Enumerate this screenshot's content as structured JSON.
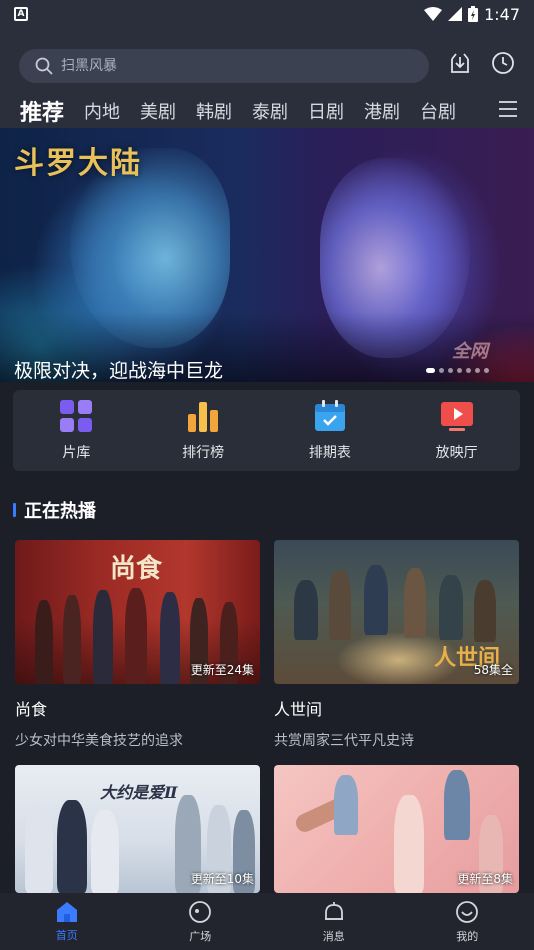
{
  "status_bar": {
    "time": "1:47"
  },
  "search": {
    "placeholder": "扫黑风暴"
  },
  "tabs": [
    {
      "label": "推荐"
    },
    {
      "label": "内地"
    },
    {
      "label": "美剧"
    },
    {
      "label": "韩剧"
    },
    {
      "label": "泰剧"
    },
    {
      "label": "日剧"
    },
    {
      "label": "港剧"
    },
    {
      "label": "台剧"
    }
  ],
  "banner": {
    "logo_text": "斗罗大陆",
    "caption": "极限对决，迎战海中巨龙",
    "watermark": "全网",
    "slide_count": 7,
    "active_slide": 1
  },
  "quick_links": [
    {
      "label": "片库",
      "icon": "grid-icon"
    },
    {
      "label": "排行榜",
      "icon": "bar-chart-icon"
    },
    {
      "label": "排期表",
      "icon": "calendar-icon"
    },
    {
      "label": "放映厅",
      "icon": "play-screen-icon"
    }
  ],
  "section": {
    "title": "正在热播"
  },
  "cards": [
    {
      "title": "尚食",
      "subtitle": "少女对中华美食技艺的追求",
      "badge": "更新至24集",
      "poster_text": "尚食"
    },
    {
      "title": "人世间",
      "subtitle": "共赏周家三代平凡史诗",
      "badge": "58集全",
      "poster_text": "人世间"
    },
    {
      "title": "",
      "subtitle": "",
      "badge": "更新至10集",
      "poster_text": "大约是爱Ⅱ"
    },
    {
      "title": "",
      "subtitle": "",
      "badge": "更新至8集",
      "poster_text": ""
    }
  ],
  "bottom_nav": [
    {
      "label": "首页",
      "active": true
    },
    {
      "label": "广场",
      "active": false
    },
    {
      "label": "消息",
      "active": false
    },
    {
      "label": "我的",
      "active": false
    }
  ],
  "colors": {
    "accent": "#3a7bff",
    "background": "#1c1f27",
    "header": "#2a2f3b"
  }
}
